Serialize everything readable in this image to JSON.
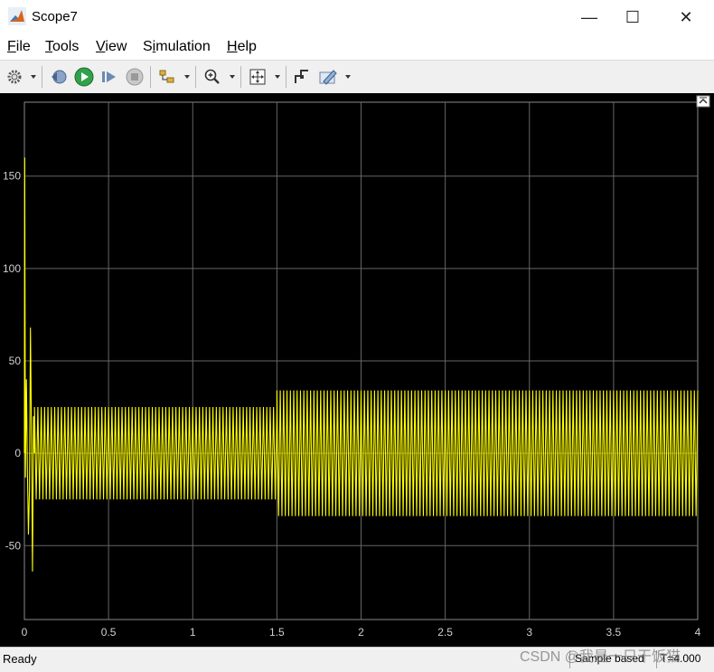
{
  "window": {
    "title": "Scope7",
    "minimize_glyph": "—",
    "maximize_glyph": "☐",
    "close_glyph": "✕"
  },
  "menu": [
    {
      "accel": "F",
      "rest": "ile"
    },
    {
      "accel": "T",
      "rest": "ools"
    },
    {
      "accel": "V",
      "rest": "iew"
    },
    {
      "accel": "",
      "pre": "S",
      "accel2": "i",
      "rest": "mulation"
    },
    {
      "accel": "H",
      "rest": "elp"
    }
  ],
  "toolbar_icons": [
    "gear-icon",
    "step-back-icon",
    "run-icon",
    "step-forward-icon",
    "stop-icon",
    "signal-select-icon",
    "zoom-in-icon",
    "fit-axes-icon",
    "cursor-measure-icon",
    "style-icon"
  ],
  "status": {
    "ready": "Ready",
    "sample": "Sample based",
    "time": "T=4.000"
  },
  "watermark": "CSDN @我是一只干饭猫",
  "colors": {
    "signal": "#ffff00",
    "background": "#000000",
    "grid": "#666666",
    "axis_text": "#cfcfcf"
  },
  "chart_data": {
    "type": "line",
    "title": "",
    "xlabel": "",
    "ylabel": "",
    "xlim": [
      0,
      4
    ],
    "ylim": [
      -90,
      190
    ],
    "xticks": [
      "0",
      "0.5",
      "1",
      "1.5",
      "2",
      "2.5",
      "3",
      "3.5",
      "4"
    ],
    "yticks": [
      "-50",
      "0",
      "50",
      "100",
      "150"
    ],
    "grid": true,
    "series": [
      {
        "frequency_hz": 50,
        "segments": [
          {
            "t_start": 0.0,
            "t_end": 0.06,
            "note": "startup transient",
            "peaks": [
              160,
              -44,
              68,
              -64
            ]
          },
          {
            "t_start": 0.06,
            "t_end": 1.5,
            "amplitude": 25
          },
          {
            "t_start": 1.5,
            "t_end": 4.0,
            "amplitude": 34
          }
        ]
      }
    ]
  }
}
